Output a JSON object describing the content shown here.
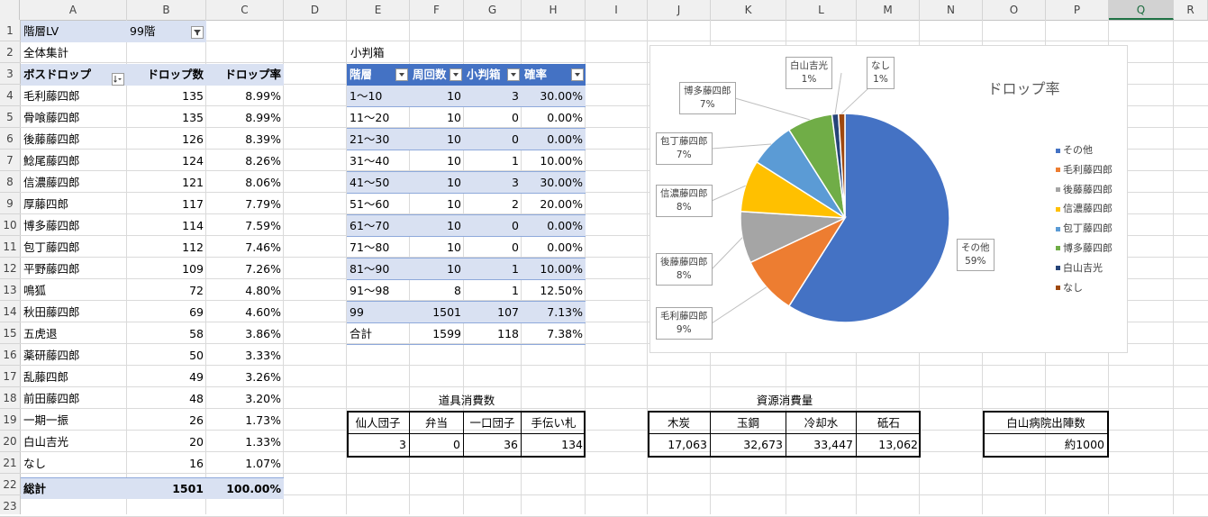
{
  "columns": [
    "A",
    "B",
    "C",
    "D",
    "E",
    "F",
    "G",
    "H",
    "I",
    "J",
    "K",
    "L",
    "M",
    "N",
    "O",
    "P",
    "Q",
    "R"
  ],
  "rows": [
    "1",
    "2",
    "3",
    "4",
    "5",
    "6",
    "7",
    "8",
    "9",
    "10",
    "11",
    "12",
    "13",
    "14",
    "15",
    "16",
    "17",
    "18",
    "19",
    "20",
    "21",
    "22",
    "23"
  ],
  "selected_column": "Q",
  "pivot": {
    "filter_label": "階層LV",
    "filter_value": "99階",
    "subtitle": "全体集計",
    "headers": {
      "name": "ボスドロップ",
      "count": "ドロップ数",
      "rate": "ドロップ率"
    },
    "rows": [
      {
        "name": "毛利藤四郎",
        "count": "135",
        "rate": "8.99%"
      },
      {
        "name": "骨喰藤四郎",
        "count": "135",
        "rate": "8.99%"
      },
      {
        "name": "後藤藤四郎",
        "count": "126",
        "rate": "8.39%"
      },
      {
        "name": "鯰尾藤四郎",
        "count": "124",
        "rate": "8.26%"
      },
      {
        "name": "信濃藤四郎",
        "count": "121",
        "rate": "8.06%"
      },
      {
        "name": "厚藤四郎",
        "count": "117",
        "rate": "7.79%"
      },
      {
        "name": "博多藤四郎",
        "count": "114",
        "rate": "7.59%"
      },
      {
        "name": "包丁藤四郎",
        "count": "112",
        "rate": "7.46%"
      },
      {
        "name": "平野藤四郎",
        "count": "109",
        "rate": "7.26%"
      },
      {
        "name": "鳴狐",
        "count": "72",
        "rate": "4.80%"
      },
      {
        "name": "秋田藤四郎",
        "count": "69",
        "rate": "4.60%"
      },
      {
        "name": "五虎退",
        "count": "58",
        "rate": "3.86%"
      },
      {
        "name": "薬研藤四郎",
        "count": "50",
        "rate": "3.33%"
      },
      {
        "name": "乱藤四郎",
        "count": "49",
        "rate": "3.26%"
      },
      {
        "name": "前田藤四郎",
        "count": "48",
        "rate": "3.20%"
      },
      {
        "name": "一期一振",
        "count": "26",
        "rate": "1.73%"
      },
      {
        "name": "白山吉光",
        "count": "20",
        "rate": "1.33%"
      },
      {
        "name": "なし",
        "count": "16",
        "rate": "1.07%"
      }
    ],
    "total": {
      "name": "総計",
      "count": "1501",
      "rate": "100.00%"
    }
  },
  "koban": {
    "title": "小判箱",
    "headers": [
      "階層",
      "周回数",
      "小判箱",
      "確率"
    ],
    "rows": [
      [
        "1～10",
        "10",
        "3",
        "30.00%"
      ],
      [
        "11～20",
        "10",
        "0",
        "0.00%"
      ],
      [
        "21～30",
        "10",
        "0",
        "0.00%"
      ],
      [
        "31～40",
        "10",
        "1",
        "10.00%"
      ],
      [
        "41～50",
        "10",
        "3",
        "30.00%"
      ],
      [
        "51～60",
        "10",
        "2",
        "20.00%"
      ],
      [
        "61～70",
        "10",
        "0",
        "0.00%"
      ],
      [
        "71～80",
        "10",
        "0",
        "0.00%"
      ],
      [
        "81～90",
        "10",
        "1",
        "10.00%"
      ],
      [
        "91～98",
        "8",
        "1",
        "12.50%"
      ],
      [
        "99",
        "1501",
        "107",
        "7.13%"
      ],
      [
        "合計",
        "1599",
        "118",
        "7.38%"
      ]
    ]
  },
  "items": {
    "title": "道具消費数",
    "headers": [
      "仙人団子",
      "弁当",
      "一口団子",
      "手伝い札"
    ],
    "values": [
      "3",
      "0",
      "36",
      "134"
    ]
  },
  "resources": {
    "title": "資源消費量",
    "headers": [
      "木炭",
      "玉鋼",
      "冷却水",
      "砥石"
    ],
    "values": [
      "17,063",
      "32,673",
      "33,447",
      "13,062"
    ]
  },
  "hakusan": {
    "header": "白山病院出陣数",
    "value": "約1000"
  },
  "chart_data": {
    "type": "pie",
    "title": "ドロップ率",
    "legend_position": "right",
    "slices": [
      {
        "name": "その他",
        "value": 59,
        "label": "59%",
        "color": "#4472c4"
      },
      {
        "name": "毛利藤四郎",
        "value": 9,
        "label": "9%",
        "color": "#ed7d31"
      },
      {
        "name": "後藤藤四郎",
        "value": 8,
        "label": "8%",
        "color": "#a5a5a5"
      },
      {
        "name": "信濃藤四郎",
        "value": 8,
        "label": "8%",
        "color": "#ffc000"
      },
      {
        "name": "包丁藤四郎",
        "value": 7,
        "label": "7%",
        "color": "#5b9bd5"
      },
      {
        "name": "博多藤四郎",
        "value": 7,
        "label": "7%",
        "color": "#70ad47"
      },
      {
        "name": "白山吉光",
        "value": 1,
        "label": "1%",
        "color": "#264478"
      },
      {
        "name": "なし",
        "value": 1,
        "label": "1%",
        "color": "#9e480e"
      }
    ]
  }
}
